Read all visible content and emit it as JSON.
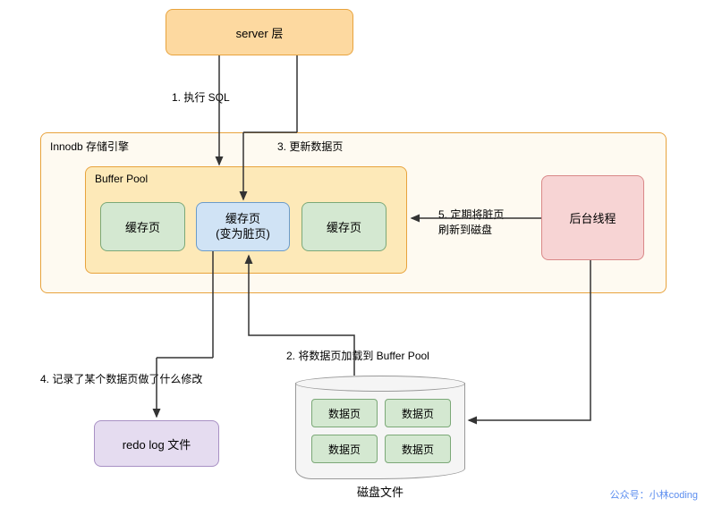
{
  "server": {
    "label": "server 层"
  },
  "innodb": {
    "label": "Innodb 存储引擎"
  },
  "buffer_pool": {
    "label": "Buffer Pool"
  },
  "cache_pages": {
    "left": "缓存页",
    "mid_line1": "缓存页",
    "mid_line2": "(变为脏页)",
    "right": "缓存页"
  },
  "bg_thread": {
    "label": "后台线程"
  },
  "redo": {
    "label": "redo log 文件"
  },
  "disk": {
    "label": "磁盘文件",
    "page": "数据页"
  },
  "steps": {
    "s1": "1. 执行 SQL",
    "s2": "2. 将数据页加载到 Buffer Pool",
    "s3": "3. 更新数据页",
    "s4": "4. 记录了某个数据页做了什么修改",
    "s5_line1": "5. 定期将脏页",
    "s5_line2": "刷新到磁盘"
  },
  "watermark": "公众号：小林coding"
}
